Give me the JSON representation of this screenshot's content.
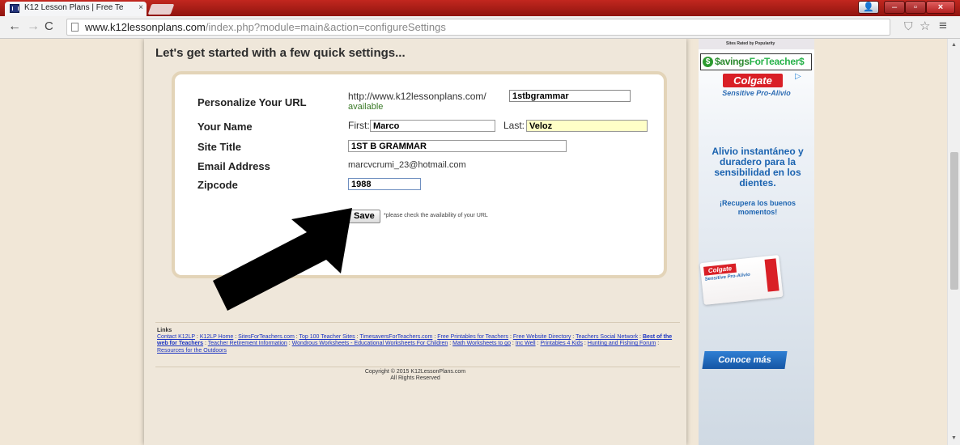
{
  "browser": {
    "tab_title": "K12 Lesson Plans | Free Te",
    "tab_close": "×",
    "url_domain": "www.k12lessonplans.com",
    "url_path": "/index.php?module=main&action=configureSettings",
    "icons": {
      "back": "←",
      "forward": "→",
      "reload": "C",
      "shield": "⛉",
      "star": "☆",
      "menu": "≡",
      "minimize": "–",
      "maximize": "▫",
      "close": "×",
      "user": "👤"
    }
  },
  "settings": {
    "heading": "Let's get started with a few quick settings...",
    "url_label": "Personalize Your URL",
    "url_prefix": "http://www.k12lessonplans.com/",
    "url_value": "1stbgrammar",
    "url_status": "available",
    "name_label": "Your Name",
    "first_label": "First:",
    "first_value": "Marco",
    "last_label": "Last:",
    "last_value": "Veloz",
    "site_title_label": "Site Title",
    "site_title_value": "1ST B GRAMMAR",
    "email_label": "Email Address",
    "email_value": "marcvcrumi_23@hotmail.com",
    "zip_label": "Zipcode",
    "zip_value": "1988",
    "save_label": "Save",
    "save_note": "*please check the availability of your URL"
  },
  "footer": {
    "links_heading": "Links",
    "links": [
      {
        "text": "Contact K12LP",
        "bold": false
      },
      {
        "text": "K12LP Home",
        "bold": false
      },
      {
        "text": "SitesForTeachers.com",
        "bold": false
      },
      {
        "text": "Top 100 Teacher Sites",
        "bold": false
      },
      {
        "text": "TimesaversForTeachers.com",
        "bold": false
      },
      {
        "text": "Free Printables for Teachers",
        "bold": false
      },
      {
        "text": "Free Website Directory",
        "bold": false
      },
      {
        "text": "Teachers Social Network",
        "bold": false
      },
      {
        "text": "Best of the web for Teachers",
        "bold": true
      },
      {
        "text": "Teacher Retirement Information",
        "bold": false
      },
      {
        "text": "Wondrous Worksheets - Educational Worksheets For Children",
        "bold": false
      },
      {
        "text": "Math Worksheets to go",
        "bold": false
      },
      {
        "text": "Inc Well",
        "bold": false
      },
      {
        "text": "Printables 4 Kids",
        "bold": false
      },
      {
        "text": "Hunting and Fishing Forum",
        "bold": false
      },
      {
        "text": "Resources for the Outdoors",
        "bold": false
      }
    ],
    "copyright_line1": "Copyright © 2015 K12LessonPlans.com",
    "copyright_line2": "All Rights Reserved"
  },
  "ad": {
    "rated_text": "Sites Rated by Popularity",
    "savings_icon": "$",
    "savings_text_a": "$avings",
    "savings_text_b": "ForTeacher$",
    "brand": "Colgate",
    "adchoices": "▷",
    "sub_brand": "Sensitive Pro-Alivio",
    "headline": "Alivio instantáneo y duradero para la sensibilidad en los dientes.",
    "tagline": "¡Recupera los buenos momentos!",
    "product_brand": "Colgate",
    "product_sub": "Sensitive Pro-Alivio",
    "cta": "Conoce más"
  },
  "scrollbar": {
    "up": "▲",
    "down": "▼"
  }
}
